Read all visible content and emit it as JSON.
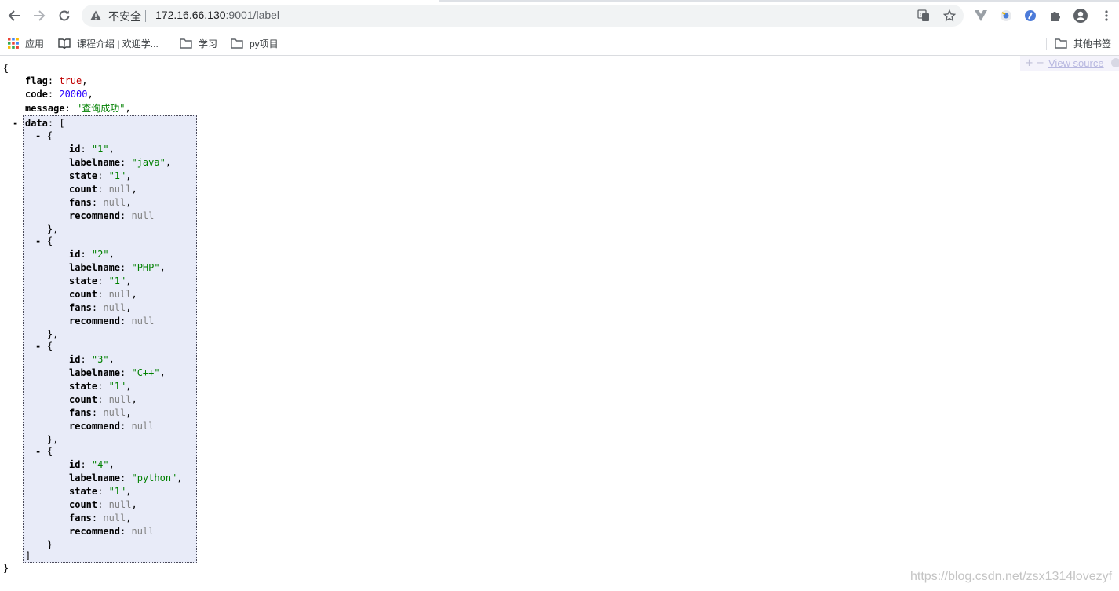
{
  "browser": {
    "security_label": "不安全",
    "url_host": "172.16.66.130",
    "url_path": ":9001/label",
    "bookmarks": {
      "apps": "应用",
      "course": "课程介绍 | 欢迎学...",
      "study": "学习",
      "py_project": "py项目",
      "other": "其他书签"
    }
  },
  "viewer": {
    "plus": "+",
    "minus": "−",
    "view_source": "View source"
  },
  "json": {
    "open_brace": "{",
    "close_brace": "}",
    "collapse_symbol": "-",
    "flag_key": "flag",
    "flag_value": "true",
    "code_key": "code",
    "code_value": "20000",
    "message_key": "message",
    "message_value": "\"查询成功\"",
    "data_key": "data",
    "data_open": "[",
    "data_close": "]",
    "items": [
      {
        "id": "\"1\"",
        "labelname": "\"java\"",
        "state": "\"1\"",
        "count": "null",
        "fans": "null",
        "recommend": "null"
      },
      {
        "id": "\"2\"",
        "labelname": "\"PHP\"",
        "state": "\"1\"",
        "count": "null",
        "fans": "null",
        "recommend": "null"
      },
      {
        "id": "\"3\"",
        "labelname": "\"C++\"",
        "state": "\"1\"",
        "count": "null",
        "fans": "null",
        "recommend": "null"
      },
      {
        "id": "\"4\"",
        "labelname": "\"python\"",
        "state": "\"1\"",
        "count": "null",
        "fans": "null",
        "recommend": "null"
      }
    ],
    "field_keys": {
      "id": "id",
      "labelname": "labelname",
      "state": "state",
      "count": "count",
      "fans": "fans",
      "recommend": "recommend"
    }
  },
  "watermark": "https://blog.csdn.net/zsx1314lovezyf"
}
